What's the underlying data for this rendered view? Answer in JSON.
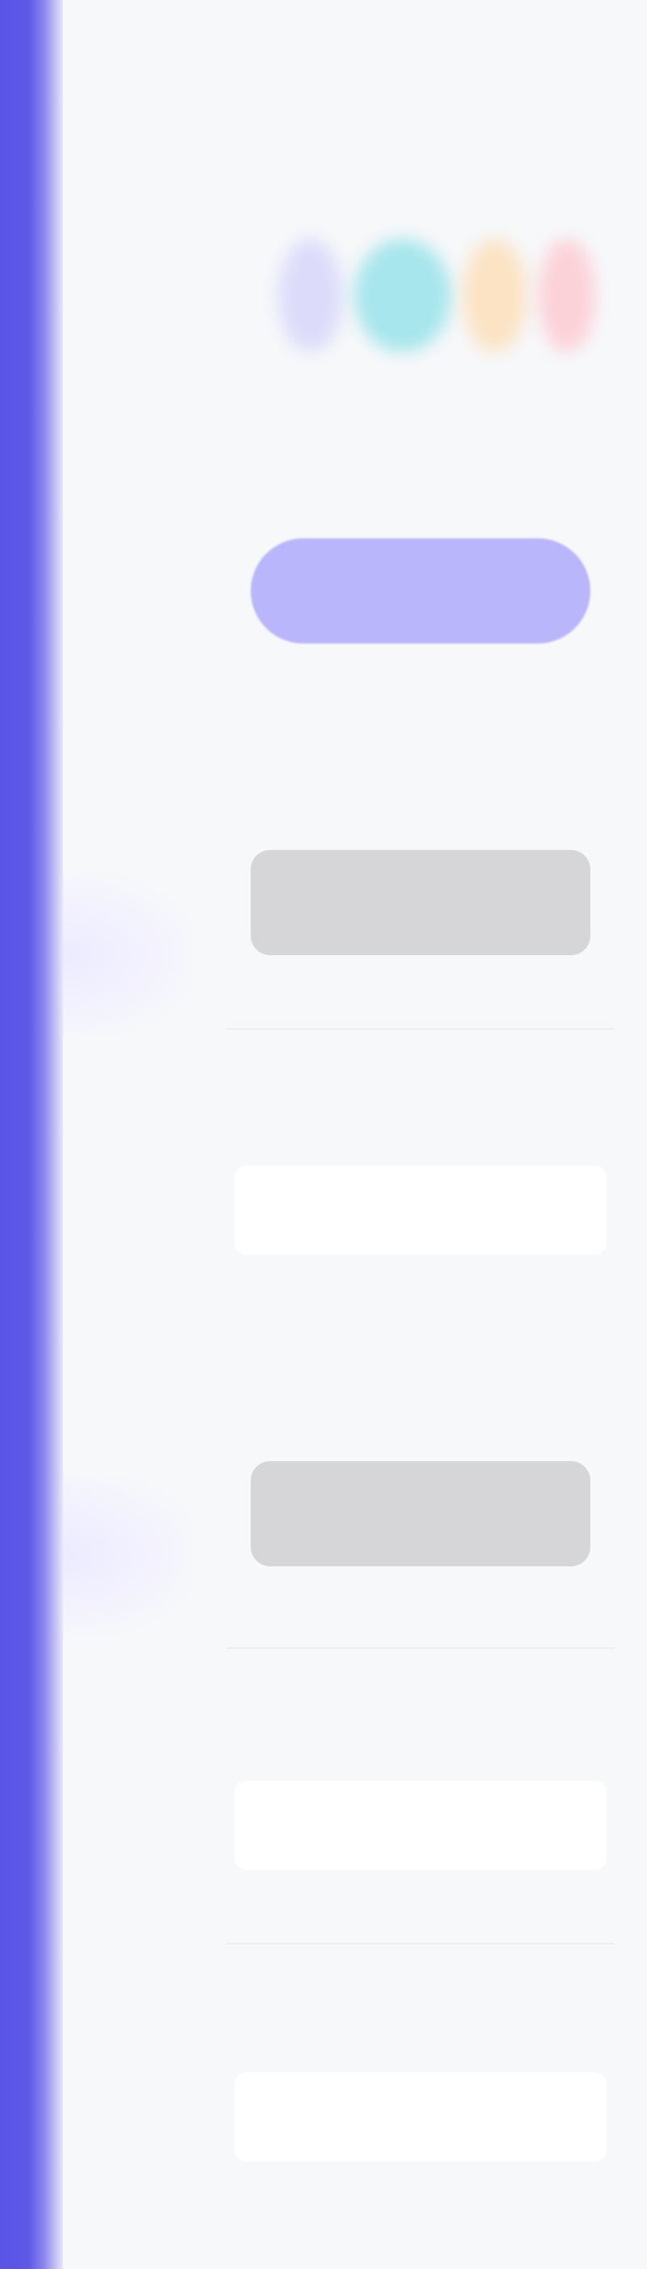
{
  "app": {
    "title": ""
  },
  "logo": {
    "alt": ""
  },
  "primary_action": {
    "label": ""
  },
  "cards": [
    {
      "label": ""
    },
    {
      "label": ""
    }
  ],
  "sections": [
    {
      "label": "",
      "value": ""
    },
    {
      "label": "",
      "value": ""
    },
    {
      "label": "",
      "value": ""
    }
  ],
  "colors": {
    "accent": "#5a54e6",
    "primary_button": "#b9b6fb",
    "card": "#d6d6d8",
    "background": "#f7f8fa"
  }
}
